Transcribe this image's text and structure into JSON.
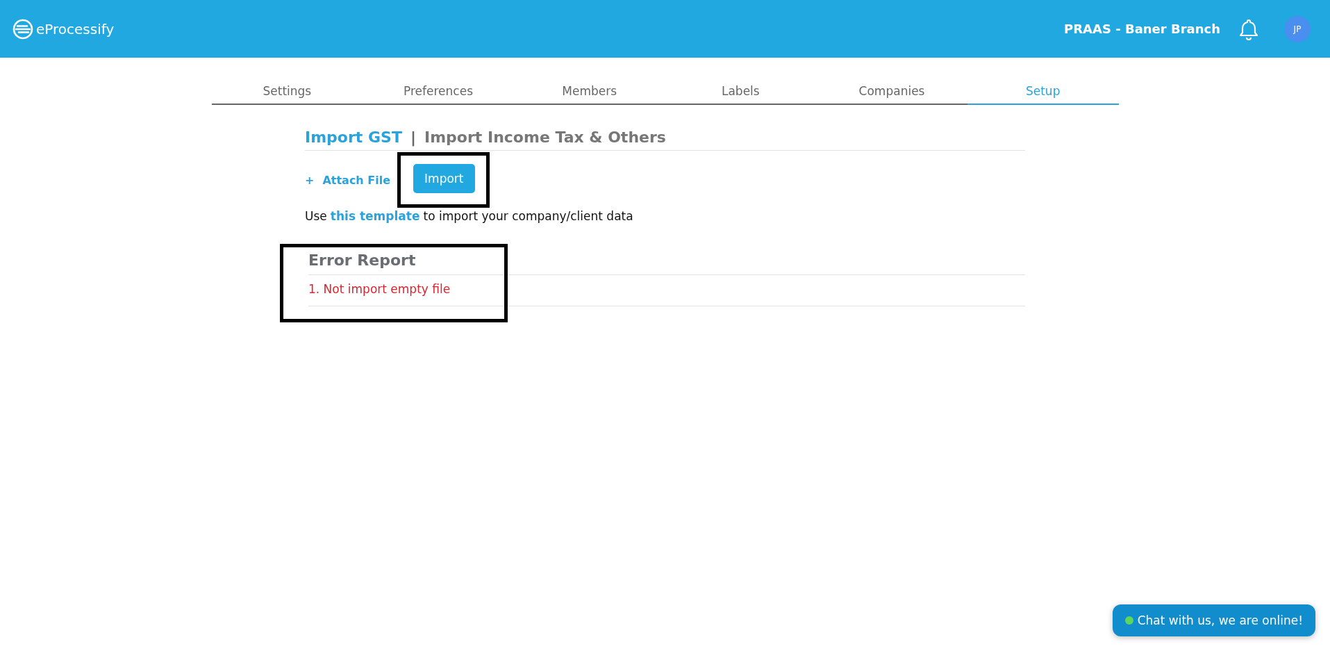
{
  "header": {
    "brand": "eProcessify",
    "branch": "PRAAS - Baner Branch",
    "avatar": "JP"
  },
  "tabs": [
    {
      "label": "Settings",
      "selected": false
    },
    {
      "label": "Preferences",
      "selected": false
    },
    {
      "label": "Members",
      "selected": false
    },
    {
      "label": "Labels",
      "selected": false
    },
    {
      "label": "Companies",
      "selected": false
    },
    {
      "label": "Setup",
      "selected": true
    }
  ],
  "import_tabs": [
    {
      "label": "Import GST",
      "selected": true
    },
    {
      "label": "Import Income Tax & Others",
      "selected": false
    }
  ],
  "separator": "|",
  "attach": {
    "icon": "+",
    "label": "Attach File"
  },
  "import_button": {
    "label": "Import",
    "highlighted": true
  },
  "template_note": {
    "before": "Use",
    "link": "this template",
    "after": "to import your company/client data"
  },
  "error_report": {
    "title": "Error Report",
    "highlighted": true,
    "errors": [
      "1. Not import empty file"
    ]
  },
  "chat": {
    "label": "Chat with us, we are online!",
    "online": true
  }
}
